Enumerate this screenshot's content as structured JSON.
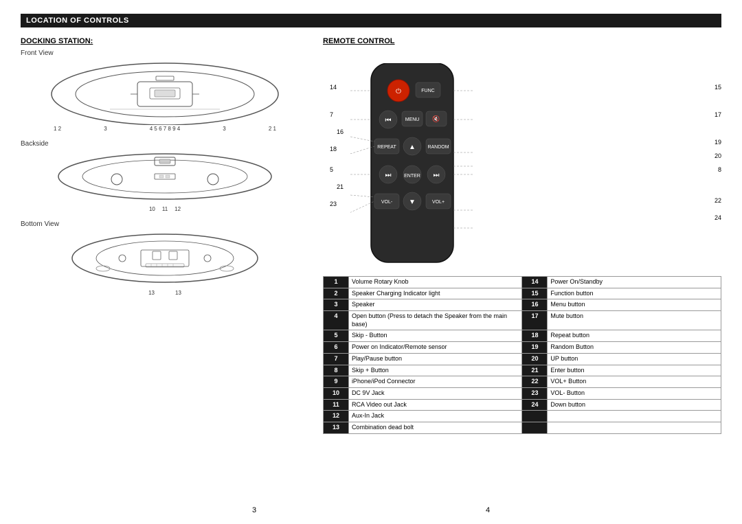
{
  "header": {
    "title": "LOCATION OF CONTROLS"
  },
  "docking_station": {
    "title": "DOCKING STATION:",
    "views": {
      "front": "Front View",
      "back": "Backside",
      "bottom": "Bottom View"
    },
    "front_numbers": [
      "1",
      "2",
      "",
      "3",
      "",
      "4",
      "5",
      "6",
      "7",
      "8",
      "9",
      "4",
      "",
      "3",
      "",
      "2",
      "1"
    ],
    "back_numbers": [
      "10",
      "11",
      "12"
    ],
    "bottom_numbers": [
      "13",
      "",
      "13"
    ]
  },
  "remote_control": {
    "title": "REMOTE CONTROL",
    "labels": {
      "14": "14",
      "15": "15",
      "7": "7",
      "16": "16",
      "17": "17",
      "18": "18",
      "19": "19",
      "20": "20",
      "5": "5",
      "8": "8",
      "21": "21",
      "23": "23",
      "22": "22",
      "24": "24"
    }
  },
  "table": {
    "rows": [
      {
        "num": "1",
        "desc": "Volume Rotary Knob",
        "num2": "14",
        "desc2": "Power On/Standby"
      },
      {
        "num": "2",
        "desc": "Speaker Charging Indicator light",
        "num2": "15",
        "desc2": "Function button"
      },
      {
        "num": "3",
        "desc": "Speaker",
        "num2": "16",
        "desc2": "Menu button"
      },
      {
        "num": "4",
        "desc": "Open button (Press to detach the Speaker from the main base)",
        "num2": "17",
        "desc2": "Mute button"
      },
      {
        "num": "5",
        "desc": "Skip - Button",
        "num2": "18",
        "desc2": "Repeat button"
      },
      {
        "num": "6",
        "desc": "Power on Indicator/Remote sensor",
        "num2": "19",
        "desc2": "Random Button"
      },
      {
        "num": "7",
        "desc": "Play/Pause button",
        "num2": "20",
        "desc2": "UP button"
      },
      {
        "num": "8",
        "desc": "Skip + Button",
        "num2": "21",
        "desc2": "Enter button"
      },
      {
        "num": "9",
        "desc": "iPhone/iPod Connector",
        "num2": "22",
        "desc2": "VOL+ Button"
      },
      {
        "num": "10",
        "desc": "DC 9V Jack",
        "num2": "23",
        "desc2": "VOL- Button"
      },
      {
        "num": "11",
        "desc": "RCA Video out Jack",
        "num2": "24",
        "desc2": "Down button"
      },
      {
        "num": "12",
        "desc": "Aux-In Jack",
        "num2": "",
        "desc2": ""
      },
      {
        "num": "13",
        "desc": "Combination dead bolt",
        "num2": "",
        "desc2": ""
      }
    ]
  },
  "page_numbers": {
    "left": "3",
    "right": "4"
  }
}
